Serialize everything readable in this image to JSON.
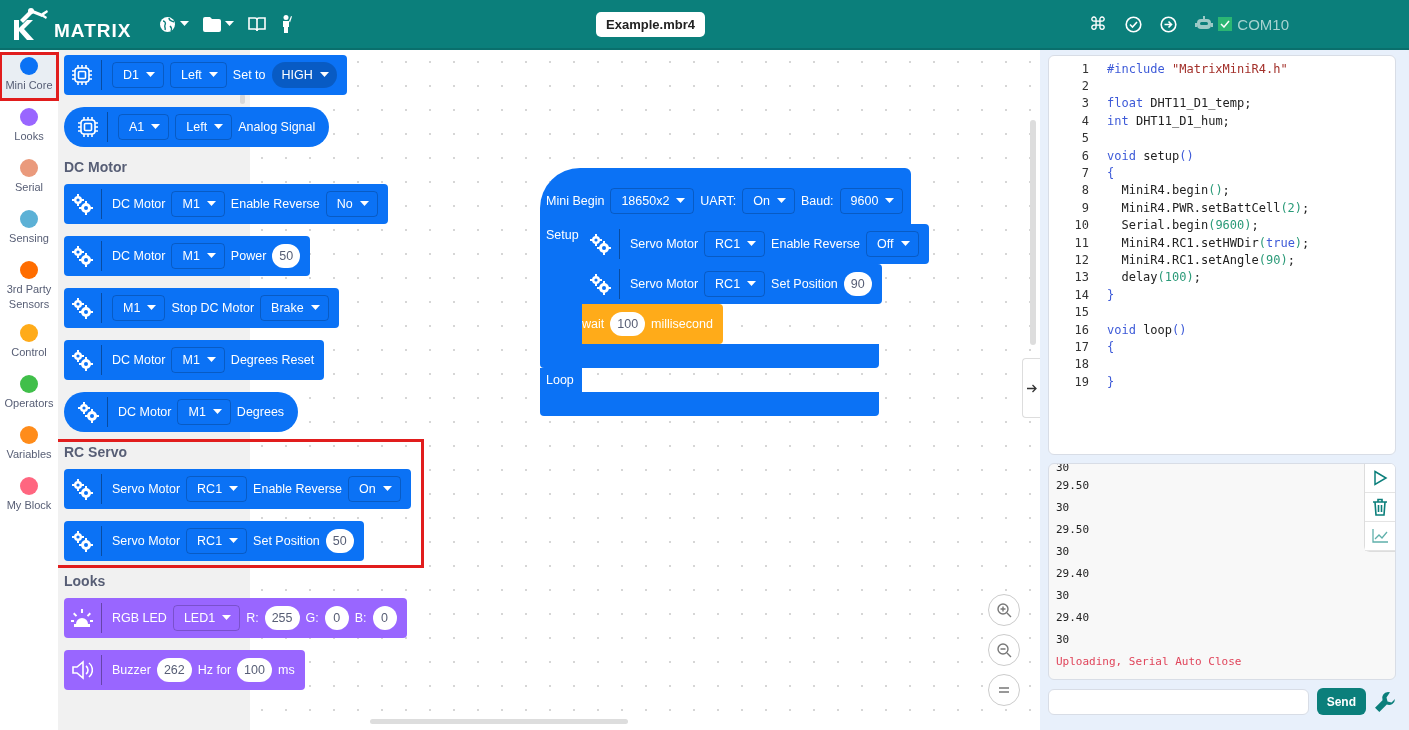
{
  "header": {
    "logo_text": "MATRIX",
    "file_name": "Example.mbr4",
    "command_symbol": "⌘",
    "port": "COM10",
    "port_connected": true
  },
  "categories": [
    {
      "label": "Mini Core",
      "color": "#0b72f5",
      "selected": true
    },
    {
      "label": "Looks",
      "color": "#9966ff",
      "selected": false
    },
    {
      "label": "Serial",
      "color": "#ea9a7c",
      "selected": false
    },
    {
      "label": "Sensing",
      "color": "#5cb1d6",
      "selected": false
    },
    {
      "label": "3rd Party Sensors",
      "color": "#ff6d00",
      "selected": false
    },
    {
      "label": "Control",
      "color": "#ffab19",
      "selected": false
    },
    {
      "label": "Operators",
      "color": "#40bf4a",
      "selected": false
    },
    {
      "label": "Variables",
      "color": "#ff8c1a",
      "selected": false
    },
    {
      "label": "My Block",
      "color": "#ff6680",
      "selected": false
    }
  ],
  "palette": [
    {
      "highlighted": false,
      "blocks": [
        {
          "kind": "chip_command",
          "color": "#0b72f5",
          "parts": [
            {
              "kind": "dropdown",
              "text": "D1"
            },
            {
              "kind": "dropdown",
              "text": "Left"
            },
            {
              "kind": "text",
              "text": "Set to"
            },
            {
              "kind": "round_dropdown",
              "text": "HIGH"
            }
          ]
        },
        {
          "kind": "chip_reporter",
          "color": "#0b72f5",
          "parts": [
            {
              "kind": "dropdown",
              "text": "A1"
            },
            {
              "kind": "dropdown",
              "text": "Left"
            },
            {
              "kind": "text",
              "text": "Analog Signal"
            }
          ]
        }
      ]
    },
    {
      "title": "DC Motor",
      "highlighted": false,
      "blocks": [
        {
          "kind": "gears_command",
          "color": "#0b72f5",
          "parts": [
            {
              "kind": "text",
              "text": "DC Motor"
            },
            {
              "kind": "dropdown",
              "text": "M1"
            },
            {
              "kind": "text",
              "text": "Enable Reverse"
            },
            {
              "kind": "dropdown",
              "text": "No"
            }
          ]
        },
        {
          "kind": "gears_command",
          "color": "#0b72f5",
          "parts": [
            {
              "kind": "text",
              "text": "DC Motor"
            },
            {
              "kind": "dropdown",
              "text": "M1"
            },
            {
              "kind": "text",
              "text": "Power"
            },
            {
              "kind": "number",
              "text": "50"
            }
          ]
        },
        {
          "kind": "gears_command",
          "color": "#0b72f5",
          "parts": [
            {
              "kind": "dropdown",
              "text": "M1"
            },
            {
              "kind": "text",
              "text": "Stop DC Motor"
            },
            {
              "kind": "dropdown",
              "text": "Brake"
            }
          ]
        },
        {
          "kind": "gears_command",
          "color": "#0b72f5",
          "parts": [
            {
              "kind": "text",
              "text": "DC Motor"
            },
            {
              "kind": "dropdown",
              "text": "M1"
            },
            {
              "kind": "text",
              "text": "Degrees Reset"
            }
          ]
        },
        {
          "kind": "gears_reporter",
          "color": "#0b72f5",
          "parts": [
            {
              "kind": "text",
              "text": "DC Motor"
            },
            {
              "kind": "dropdown",
              "text": "M1"
            },
            {
              "kind": "text",
              "text": "Degrees"
            }
          ]
        }
      ]
    },
    {
      "title": "RC Servo",
      "highlighted": true,
      "blocks": [
        {
          "kind": "gears_command",
          "color": "#0b72f5",
          "parts": [
            {
              "kind": "text",
              "text": "Servo Motor"
            },
            {
              "kind": "dropdown",
              "text": "RC1"
            },
            {
              "kind": "text",
              "text": "Enable Reverse"
            },
            {
              "kind": "dropdown",
              "text": "On"
            }
          ]
        },
        {
          "kind": "gears_command",
          "color": "#0b72f5",
          "parts": [
            {
              "kind": "text",
              "text": "Servo Motor"
            },
            {
              "kind": "dropdown",
              "text": "RC1"
            },
            {
              "kind": "text",
              "text": "Set Position"
            },
            {
              "kind": "number",
              "text": "50"
            }
          ]
        }
      ]
    },
    {
      "title": "Looks",
      "highlighted": false,
      "blocks": [
        {
          "kind": "alarm_command",
          "color": "#9966ff",
          "parts": [
            {
              "kind": "text",
              "text": "RGB LED"
            },
            {
              "kind": "dropdown",
              "text": "LED1"
            },
            {
              "kind": "text",
              "text": "R:"
            },
            {
              "kind": "number",
              "text": "255"
            },
            {
              "kind": "text",
              "text": "G:"
            },
            {
              "kind": "number",
              "text": "0"
            },
            {
              "kind": "text",
              "text": "B:"
            },
            {
              "kind": "number",
              "text": "0"
            }
          ]
        },
        {
          "kind": "speaker_command",
          "color": "#9966ff",
          "parts": [
            {
              "kind": "text",
              "text": "Buzzer"
            },
            {
              "kind": "number",
              "text": "262"
            },
            {
              "kind": "text",
              "text": "Hz for"
            },
            {
              "kind": "number",
              "text": "100"
            },
            {
              "kind": "text",
              "text": "ms"
            }
          ]
        }
      ]
    }
  ],
  "script": {
    "color": "#0b72f5",
    "hat": [
      {
        "kind": "text",
        "text": "Mini Begin"
      },
      {
        "kind": "dropdown",
        "text": "18650x2"
      },
      {
        "kind": "text",
        "text": "UART:"
      },
      {
        "kind": "dropdown",
        "text": "On"
      },
      {
        "kind": "text",
        "text": "Baud:"
      },
      {
        "kind": "dropdown",
        "text": "9600"
      }
    ],
    "sections": [
      {
        "label": "Setup",
        "blocks": [
          {
            "kind": "gears_command",
            "color": "#0b72f5",
            "parts": [
              {
                "kind": "text",
                "text": "Servo Motor"
              },
              {
                "kind": "dropdown",
                "text": "RC1"
              },
              {
                "kind": "text",
                "text": "Enable Reverse"
              },
              {
                "kind": "dropdown",
                "text": "Off"
              }
            ]
          },
          {
            "kind": "gears_command",
            "color": "#0b72f5",
            "parts": [
              {
                "kind": "text",
                "text": "Servo Motor"
              },
              {
                "kind": "dropdown",
                "text": "RC1"
              },
              {
                "kind": "text",
                "text": "Set Position"
              },
              {
                "kind": "number",
                "text": "90"
              }
            ]
          },
          {
            "kind": "plain_command",
            "color": "#ffab19",
            "parts": [
              {
                "kind": "text",
                "text": "wait"
              },
              {
                "kind": "number",
                "text": "100"
              },
              {
                "kind": "text",
                "text": "millisecond"
              }
            ]
          }
        ]
      },
      {
        "label": "Loop"
      }
    ]
  },
  "code": [
    {
      "n": "1",
      "tokens": [
        {
          "kind": "kw",
          "text": "#include"
        },
        {
          "kind": "str",
          "text": " \"MatrixMiniR4.h\""
        }
      ]
    },
    {
      "n": "2"
    },
    {
      "n": "3",
      "tokens": [
        {
          "kind": "kw",
          "text": "float"
        },
        {
          "kind": "plain",
          "text": " DHT11_D1_temp;"
        }
      ]
    },
    {
      "n": "4",
      "tokens": [
        {
          "kind": "kw",
          "text": "int"
        },
        {
          "kind": "plain",
          "text": " DHT11_D1_hum;"
        }
      ]
    },
    {
      "n": "5"
    },
    {
      "n": "6",
      "tokens": [
        {
          "kind": "kw",
          "text": "void"
        },
        {
          "kind": "plain",
          "text": " setup"
        },
        {
          "kind": "kw",
          "text": "()"
        }
      ]
    },
    {
      "n": "7",
      "tokens": [
        {
          "kind": "kw",
          "text": "{"
        }
      ]
    },
    {
      "n": "8",
      "tokens": [
        {
          "kind": "plain",
          "text": "  MiniR4.begin"
        },
        {
          "kind": "num",
          "text": "()"
        },
        {
          "kind": "plain",
          "text": ";"
        }
      ]
    },
    {
      "n": "9",
      "tokens": [
        {
          "kind": "plain",
          "text": "  MiniR4.PWR.setBattCell"
        },
        {
          "kind": "num",
          "text": "(2)"
        },
        {
          "kind": "plain",
          "text": ";"
        }
      ]
    },
    {
      "n": "10",
      "tokens": [
        {
          "kind": "plain",
          "text": "  Serial.begin"
        },
        {
          "kind": "num",
          "text": "(9600)"
        },
        {
          "kind": "plain",
          "text": ";"
        }
      ]
    },
    {
      "n": "11",
      "tokens": [
        {
          "kind": "plain",
          "text": "  MiniR4.RC1.setHWDir"
        },
        {
          "kind": "num",
          "text": "("
        },
        {
          "kind": "kw",
          "text": "true"
        },
        {
          "kind": "num",
          "text": ")"
        },
        {
          "kind": "plain",
          "text": ";"
        }
      ]
    },
    {
      "n": "12",
      "tokens": [
        {
          "kind": "plain",
          "text": "  MiniR4.RC1.setAngle"
        },
        {
          "kind": "num",
          "text": "(90)"
        },
        {
          "kind": "plain",
          "text": ";"
        }
      ]
    },
    {
      "n": "13",
      "tokens": [
        {
          "kind": "plain",
          "text": "  delay"
        },
        {
          "kind": "num",
          "text": "(100)"
        },
        {
          "kind": "plain",
          "text": ";"
        }
      ]
    },
    {
      "n": "14",
      "tokens": [
        {
          "kind": "kw",
          "text": "}"
        }
      ]
    },
    {
      "n": "15"
    },
    {
      "n": "16",
      "tokens": [
        {
          "kind": "kw",
          "text": "void"
        },
        {
          "kind": "plain",
          "text": " loop"
        },
        {
          "kind": "kw",
          "text": "()"
        }
      ]
    },
    {
      "n": "17",
      "tokens": [
        {
          "kind": "kw",
          "text": "{"
        }
      ]
    },
    {
      "n": "18"
    },
    {
      "n": "19",
      "tokens": [
        {
          "kind": "kw",
          "text": "}"
        }
      ]
    }
  ],
  "serial": {
    "lines": [
      {
        "text": "30",
        "kind": "output"
      },
      {
        "text": "29.50",
        "kind": "output"
      },
      {
        "text": "30",
        "kind": "output"
      },
      {
        "text": "29.50",
        "kind": "output"
      },
      {
        "text": "30",
        "kind": "output"
      },
      {
        "text": "29.40",
        "kind": "output"
      },
      {
        "text": "30",
        "kind": "output"
      },
      {
        "text": "29.40",
        "kind": "output"
      },
      {
        "text": "30",
        "kind": "output"
      },
      {
        "text": "Uploading, Serial Auto Close",
        "kind": "error"
      }
    ],
    "send_label": "Send"
  }
}
